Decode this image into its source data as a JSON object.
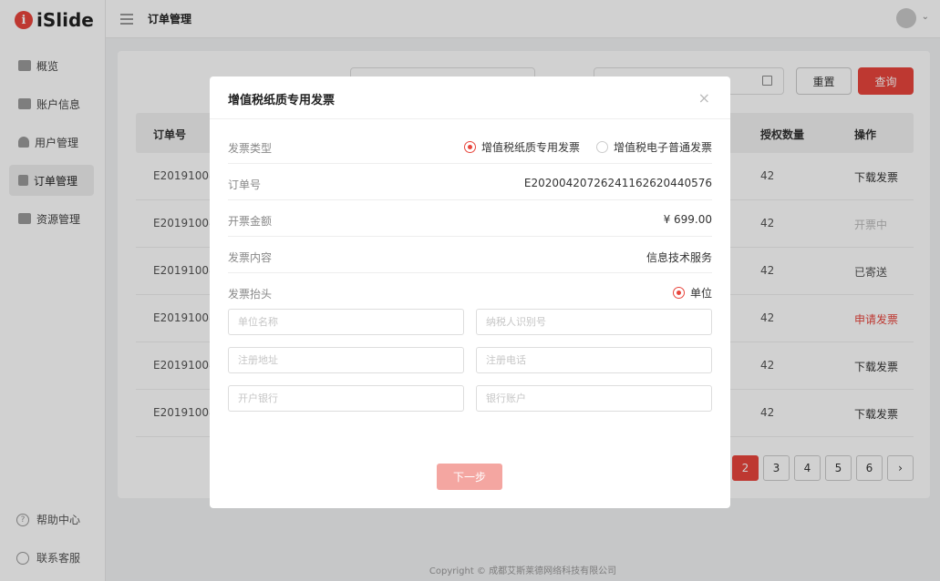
{
  "app": {
    "logo_text": "iSlide",
    "logo_letter": "i"
  },
  "header": {
    "title": "订单管理"
  },
  "sidebar": {
    "items": [
      {
        "label": "概览",
        "icon": "grid-icon"
      },
      {
        "label": "账户信息",
        "icon": "card-icon"
      },
      {
        "label": "用户管理",
        "icon": "user-icon"
      },
      {
        "label": "订单管理",
        "icon": "clipboard-icon",
        "active": true
      },
      {
        "label": "资源管理",
        "icon": "chart-icon"
      }
    ],
    "help": "帮助中心",
    "service": "联系客服"
  },
  "filters": {
    "reset": "重置",
    "query": "查询"
  },
  "table": {
    "headers": {
      "order_no": "订单号",
      "auth_count": "授权数量",
      "action": "操作"
    },
    "rows": [
      {
        "order_no": "E201910086",
        "count": "42",
        "action": "下载发票"
      },
      {
        "order_no": "E201910086",
        "count": "42",
        "action": "开票中"
      },
      {
        "order_no": "E201910086",
        "count": "42",
        "action": "已寄送"
      },
      {
        "order_no": "E201910086",
        "count": "42",
        "action": "申请发票"
      },
      {
        "order_no": "E201910086",
        "count": "42",
        "action": "下载发票"
      },
      {
        "order_no": "E201910086",
        "count": "42",
        "action": "下载发票"
      }
    ]
  },
  "pagination": {
    "pages": [
      "2",
      "3",
      "4",
      "5",
      "6"
    ],
    "active": "2",
    "next": "›"
  },
  "footer": {
    "copyright": "Copyright © 成都艾斯莱德网络科技有限公司"
  },
  "modal": {
    "title": "增值税纸质专用发票",
    "close": "×",
    "invoice_type_label": "发票类型",
    "invoice_type_options": [
      "增值税纸质专用发票",
      "增值税电子普通发票"
    ],
    "order_no_label": "订单号",
    "order_no_value": "E202004207262411626204405​76",
    "amount_label": "开票金额",
    "amount_value": "¥ 699.00",
    "content_label": "发票内容",
    "content_value": "信息技术服务",
    "header_label": "发票抬头",
    "header_option": "单位",
    "fields": {
      "company_name": "单位名称",
      "tax_id": "纳税人识别号",
      "reg_address": "注册地址",
      "reg_phone": "注册电话",
      "bank": "开户银行",
      "bank_account": "银行账户"
    },
    "next": "下一步"
  },
  "colors": {
    "accent": "#e8453c",
    "accent_light": "#f4a6a1"
  }
}
